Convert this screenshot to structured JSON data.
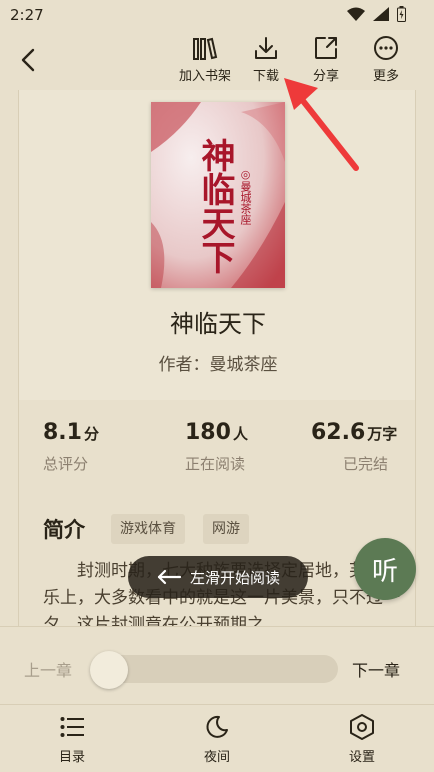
{
  "status_bar": {
    "time": "2:27"
  },
  "toolbar": {
    "add_shelf": "加入书架",
    "download": "下载",
    "share": "分享",
    "more": "更多"
  },
  "book": {
    "title": "神临天下",
    "author": "作者：曼城茶座",
    "cover_title": "神临天下",
    "cover_author": "◎曼城茶座"
  },
  "stats": {
    "rating": {
      "value": "8.1",
      "unit": "分",
      "label": "总评分"
    },
    "readers": {
      "value": "180",
      "unit": "人",
      "label": "正在阅读"
    },
    "words": {
      "value": "62.6",
      "unit": "万字",
      "label": "已完结"
    }
  },
  "intro": {
    "heading": "简介",
    "tags": [
      "游戏体育",
      "网游"
    ],
    "text": "封测时期，七大种族要选择定居地，芙帝美乐上，大多数看中的就是这一片美景，只不过一夕，这片封测竟在公开预期之"
  },
  "toast": {
    "text": "左滑开始阅读"
  },
  "listen": {
    "label": "听"
  },
  "chapter_nav": {
    "prev": "上一章",
    "next": "下一章",
    "progress": 0
  },
  "bottom_nav": {
    "toc": "目录",
    "night": "夜间",
    "settings": "设置"
  },
  "colors": {
    "background": "#e8e0cc",
    "accent_green": "#5c7a54",
    "annotation_red": "#ee3a3a",
    "cover_red": "#a8162a"
  }
}
